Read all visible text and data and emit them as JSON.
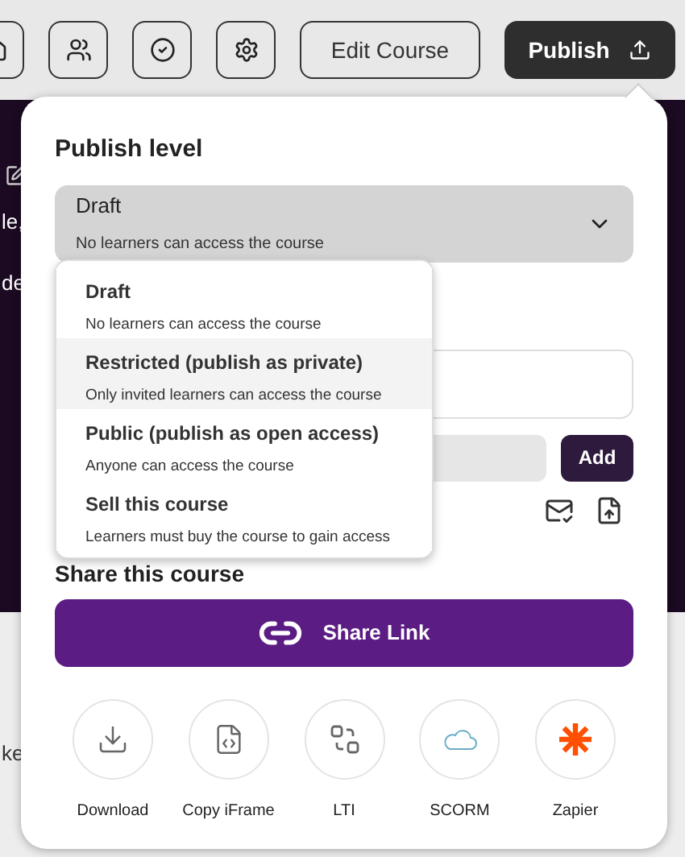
{
  "toolbar": {
    "edit_button": "Edit Course",
    "publish_button": "Publish"
  },
  "background_fragments": [
    "le,",
    "de",
    "ke"
  ],
  "publish_panel": {
    "title": "Publish level",
    "select": {
      "value": "Draft",
      "description": "No learners can access the course",
      "expanded": true
    },
    "options": [
      {
        "label": "Draft",
        "description": "No learners can access the course",
        "highlighted": false
      },
      {
        "label": "Restricted (publish as private)",
        "description": "Only invited learners can access the course",
        "highlighted": true
      },
      {
        "label": "Public (publish as open access)",
        "description": "Anyone can access the course",
        "highlighted": false
      },
      {
        "label": "Sell this course",
        "description": "Learners must buy the course to gain access",
        "highlighted": false
      }
    ],
    "add_button": "Add",
    "share_title": "Share this course",
    "share_link_button": "Share Link",
    "share_options": [
      {
        "kind": "download",
        "label": "Download"
      },
      {
        "kind": "iframe",
        "label": "Copy iFrame"
      },
      {
        "kind": "lti",
        "label": "LTI"
      },
      {
        "kind": "scorm",
        "label": "SCORM"
      },
      {
        "kind": "zapier",
        "label": "Zapier"
      }
    ]
  }
}
